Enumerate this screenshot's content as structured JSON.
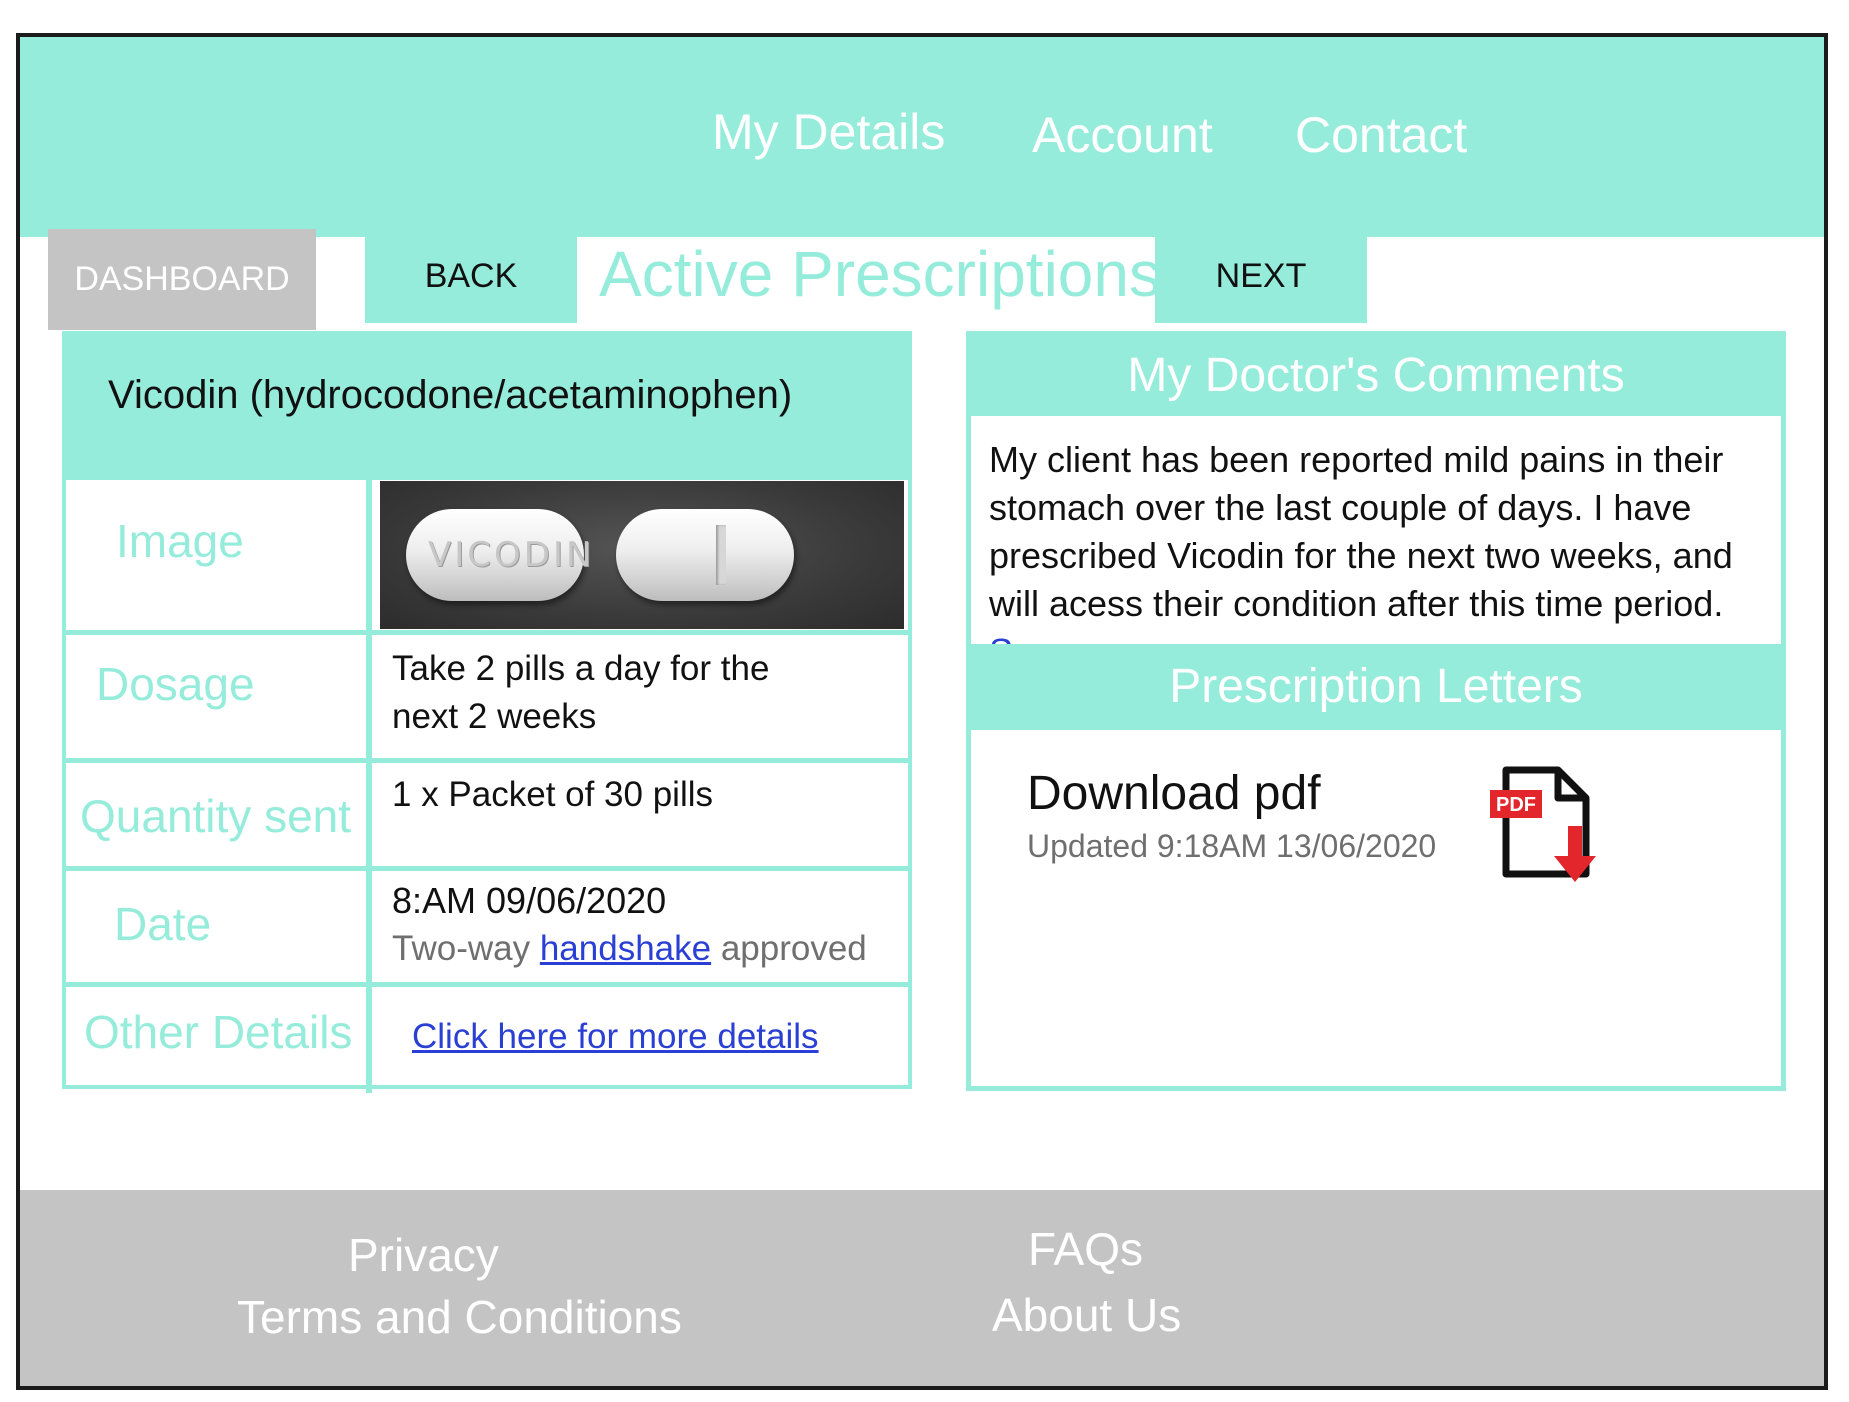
{
  "header": {
    "nav": [
      {
        "label": "My Details"
      },
      {
        "label": "Account"
      },
      {
        "label": "Contact"
      }
    ]
  },
  "toolbar": {
    "dashboard_label": "DASHBOARD",
    "back_label": "BACK",
    "next_label": "NEXT",
    "page_title": "Active Prescriptions"
  },
  "prescription": {
    "name": "Vicodin (hydrocodone/acetaminophen)",
    "image_label": "Image",
    "pill_imprint": "VICODIN",
    "dosage_label": "Dosage",
    "dosage_value": "Take 2 pills a day for the next 2 weeks",
    "quantity_label": "Quantity sent",
    "quantity_value": "1 x Packet of 30 pills",
    "date_label": "Date",
    "date_value": "8:AM 09/06/2020",
    "handshake_prefix": "Two-way",
    "handshake_link": "handshake",
    "handshake_suffix": "approved",
    "other_label": "Other Details",
    "other_link": "Click here for more details"
  },
  "doctor_comments": {
    "heading": "My Doctor's Comments",
    "text": "My client has been reported mild pains in their stomach over the last couple of days. I have prescribed Vicodin for the next two weeks, and will acess their condition after this time period.",
    "see_more": "See more"
  },
  "prescription_letters": {
    "heading": "Prescription Letters",
    "download_label": "Download pdf",
    "updated": "Updated 9:18AM 13/06/2020",
    "pdf_badge": "PDF",
    "icon": "pdf-download-icon"
  },
  "footer": {
    "privacy": "Privacy",
    "terms": "Terms and Conditions",
    "faqs": "FAQs",
    "about": "About Us"
  },
  "colors": {
    "accent": "#96ecdb",
    "footer_gray": "#c4c4c4",
    "link_blue": "#2a3fd4",
    "pdf_red": "#e3252c"
  }
}
